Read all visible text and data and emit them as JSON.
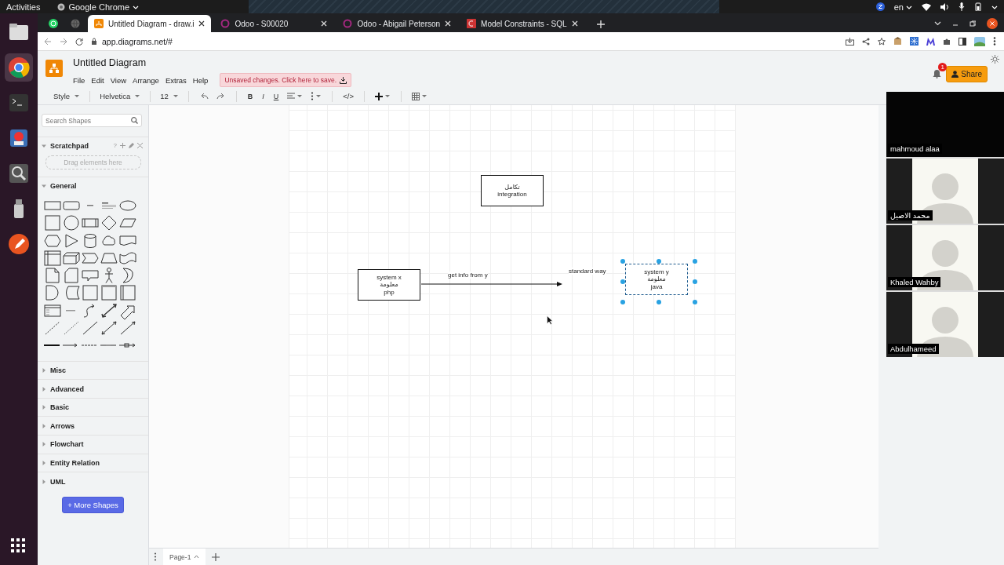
{
  "desktop": {
    "activities": "Activities",
    "app_menu": "Google Chrome",
    "keyboard_layout": "en"
  },
  "browser": {
    "tabs": [
      {
        "kind": "whatsapp",
        "selected": false
      },
      {
        "kind": "globe",
        "selected": false
      },
      {
        "kind": "drawio",
        "title": "Untitled Diagram - draw.i",
        "selected": true
      },
      {
        "kind": "odoo",
        "title": "Odoo - S00020",
        "selected": false
      },
      {
        "kind": "odoo",
        "title": "Odoo - Abigail Peterson",
        "selected": false
      },
      {
        "kind": "sql",
        "title": "Model Constraints - SQL",
        "selected": false
      }
    ],
    "url": "app.diagrams.net/#"
  },
  "app": {
    "title": "Untitled Diagram",
    "menu": [
      "File",
      "Edit",
      "View",
      "Arrange",
      "Extras",
      "Help"
    ],
    "unsaved_notice": "Unsaved changes. Click here to save.",
    "notification_count": "1",
    "share_button": "Share"
  },
  "toolbar": {
    "style": "Style",
    "font": "Helvetica",
    "font_size": "12",
    "text_format": [
      "B",
      "I",
      "U"
    ],
    "html_button": "</>"
  },
  "sidebar": {
    "search": {
      "placeholder": "Search Shapes"
    },
    "scratchpad": {
      "title": "Scratchpad",
      "help": "?",
      "drop_hint": "Drag elements here",
      "expanded": true
    },
    "sections": [
      {
        "title": "General",
        "expanded": true
      },
      {
        "title": "Misc",
        "expanded": false
      },
      {
        "title": "Advanced",
        "expanded": false
      },
      {
        "title": "Basic",
        "expanded": false
      },
      {
        "title": "Arrows",
        "expanded": false
      },
      {
        "title": "Flowchart",
        "expanded": false
      },
      {
        "title": "Entity Relation",
        "expanded": false
      },
      {
        "title": "UML",
        "expanded": false
      }
    ],
    "more_shapes_button": "+ More Shapes"
  },
  "diagram": {
    "nodes": [
      {
        "lines": [
          "تكامل",
          "integration"
        ],
        "selected": false
      },
      {
        "lines": [
          "system x",
          "معلومة",
          "php"
        ],
        "selected": false
      },
      {
        "lines": [
          "system y",
          "معلومة",
          "java"
        ],
        "selected": true
      }
    ],
    "edges": [
      {
        "label": "get info from y"
      }
    ],
    "labels": [
      "standard way"
    ]
  },
  "pages": [
    {
      "name": "Page-1",
      "selected": true
    }
  ],
  "call": {
    "participants": [
      {
        "name": "mahmoud alaa",
        "kind": "blank"
      },
      {
        "name": "محمد الاصيل",
        "kind": "avatar"
      },
      {
        "name": "Khaled Wahby",
        "kind": "avatar"
      },
      {
        "name": "Abdulhameed",
        "kind": "avatar"
      }
    ]
  }
}
